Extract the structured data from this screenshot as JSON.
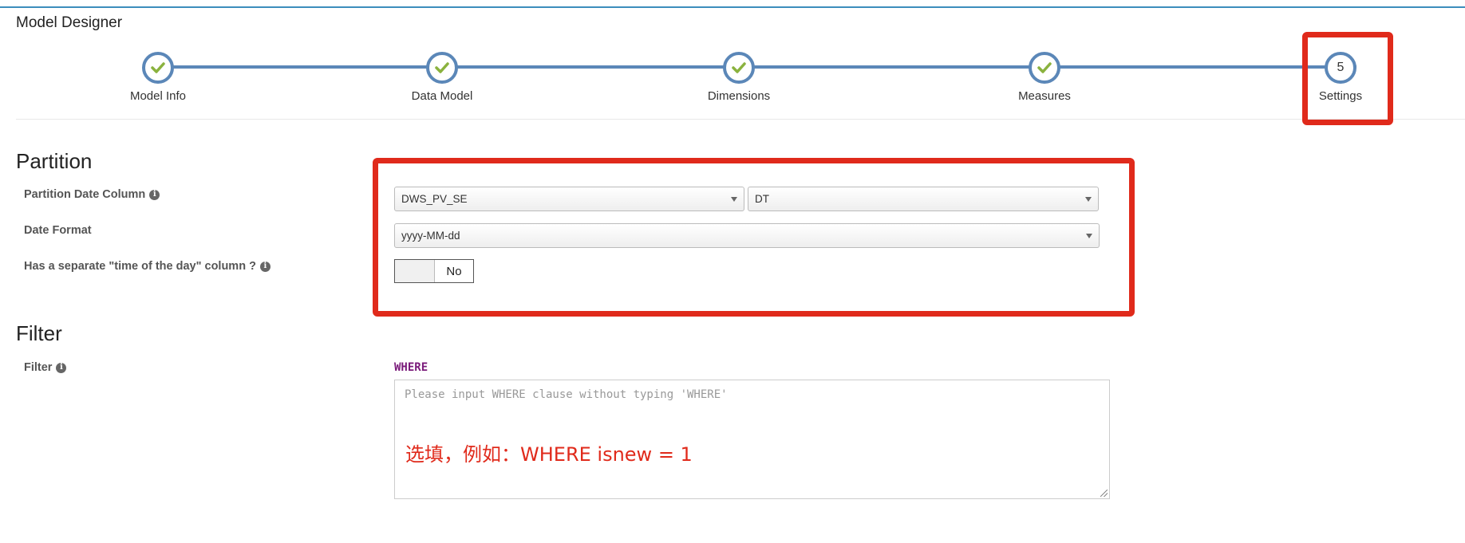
{
  "app": {
    "title": "Model Designer"
  },
  "wizard": {
    "steps": [
      {
        "label": "Model Info",
        "status": "done",
        "icon": "check-icon"
      },
      {
        "label": "Data Model",
        "status": "done",
        "icon": "check-icon"
      },
      {
        "label": "Dimensions",
        "status": "done",
        "icon": "check-icon"
      },
      {
        "label": "Measures",
        "status": "done",
        "icon": "check-icon"
      },
      {
        "label": "Settings",
        "status": "current",
        "number": "5"
      }
    ],
    "line_color": "#5b87b8",
    "check_color": "#8ab23e"
  },
  "partition": {
    "title": "Partition",
    "date_column_label": "Partition Date Column",
    "table_select": "DWS_PV_SE",
    "column_select": "DT",
    "date_format_label": "Date Format",
    "date_format_select": "yyyy-MM-dd",
    "time_column_label": "Has a separate \"time of the day\" column ?",
    "time_column_toggle": "No"
  },
  "filter": {
    "title": "Filter",
    "label": "Filter",
    "where_keyword": "WHERE",
    "placeholder": "Please input WHERE clause without typing 'WHERE'",
    "value": ""
  },
  "annotation": {
    "text": "选填，例如：WHERE isnew = 1",
    "color": "#e02a1b"
  }
}
